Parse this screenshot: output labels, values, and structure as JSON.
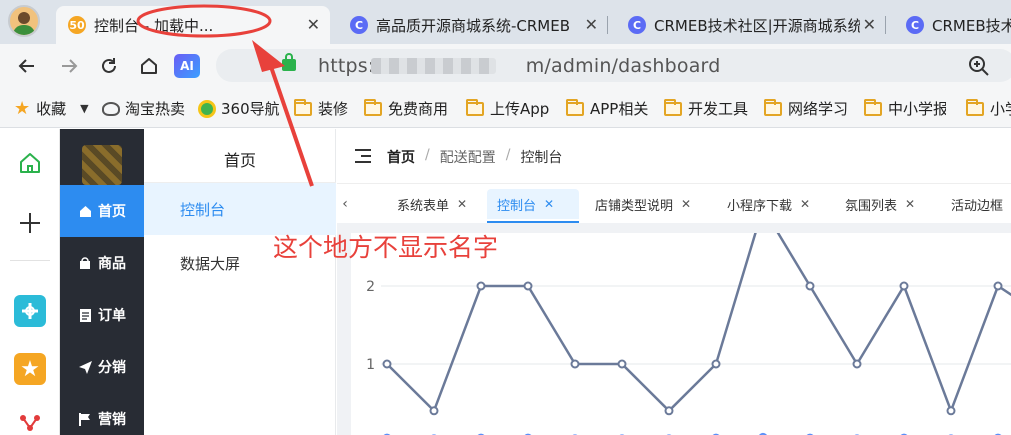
{
  "browser": {
    "tabs": [
      {
        "title": "控制台 - 加载中...",
        "favicon": "50",
        "favicon_color": "#f5a623",
        "active": true
      },
      {
        "title": "高品质开源商城系统-CRMEB",
        "favicon": "C",
        "favicon_color": "#5b6bf5"
      },
      {
        "title": "CRMEB技术社区|开源商城系统",
        "favicon": "C",
        "favicon_color": "#5b6bf5"
      },
      {
        "title": "CRMEB技术",
        "favicon": "C",
        "favicon_color": "#5b6bf5"
      }
    ],
    "close_glyph": "✕",
    "url_prefix": "https://",
    "url_suffix": "m/admin/dashboard",
    "ai_label": "AI",
    "bookmarks": [
      {
        "label": "收藏",
        "icon": "star-icon"
      },
      {
        "label": "淘宝热卖",
        "icon": "taobao-icon"
      },
      {
        "label": "360导航",
        "icon": "360-icon"
      },
      {
        "label": "装修",
        "icon": "folder-icon"
      },
      {
        "label": "免费商用",
        "icon": "folder-icon"
      },
      {
        "label": "上传App",
        "icon": "folder-icon"
      },
      {
        "label": "APP相关",
        "icon": "folder-icon"
      },
      {
        "label": "开发工具",
        "icon": "folder-icon"
      },
      {
        "label": "网络学习",
        "icon": "folder-icon"
      },
      {
        "label": "中小学报",
        "icon": "folder-icon"
      },
      {
        "label": "小学",
        "icon": "folder-icon"
      }
    ]
  },
  "darkmenu": {
    "items": [
      {
        "label": "首页",
        "icon": "home-icon",
        "active": true
      },
      {
        "label": "商品",
        "icon": "bag-icon"
      },
      {
        "label": "订单",
        "icon": "order-icon"
      },
      {
        "label": "分销",
        "icon": "send-icon"
      },
      {
        "label": "营销",
        "icon": "flag-icon"
      }
    ]
  },
  "submenu": {
    "title": "首页",
    "items": [
      {
        "label": "控制台",
        "active": true
      },
      {
        "label": "数据大屏"
      }
    ]
  },
  "breadcrumb": [
    "首页",
    "配送配置",
    "控制台"
  ],
  "page_tabs": [
    {
      "label": "系统表单"
    },
    {
      "label": "控制台",
      "active": true
    },
    {
      "label": "店铺类型说明"
    },
    {
      "label": "小程序下载"
    },
    {
      "label": "氛围列表"
    },
    {
      "label": "活动边框"
    }
  ],
  "tab_close_glyph": "✕",
  "tabs_scroll_left": "‹",
  "annotation": {
    "text": "这个地方不显示名字",
    "color": "#e8413b"
  },
  "colors": {
    "primary": "#2d8cf0",
    "sidebar_dark": "#282c34",
    "series_1": "#6b7a99",
    "series_2": "#5b8ff9"
  },
  "chart_data": {
    "type": "line",
    "yticks": [
      1,
      2
    ],
    "series": [
      {
        "values": [
          1,
          0.4,
          2,
          2,
          1,
          1,
          0.4,
          1,
          3,
          2,
          1,
          2,
          0.4,
          2,
          1.6
        ],
        "color": "#6b7a99"
      },
      {
        "values": [
          0.05,
          0.04,
          0.05,
          0.05,
          0.04,
          0.04,
          0.04,
          0.05,
          0.06,
          0.05,
          0.04,
          0.05,
          0.04,
          0.05,
          0.05
        ],
        "color": "#5b8ff9"
      }
    ]
  }
}
